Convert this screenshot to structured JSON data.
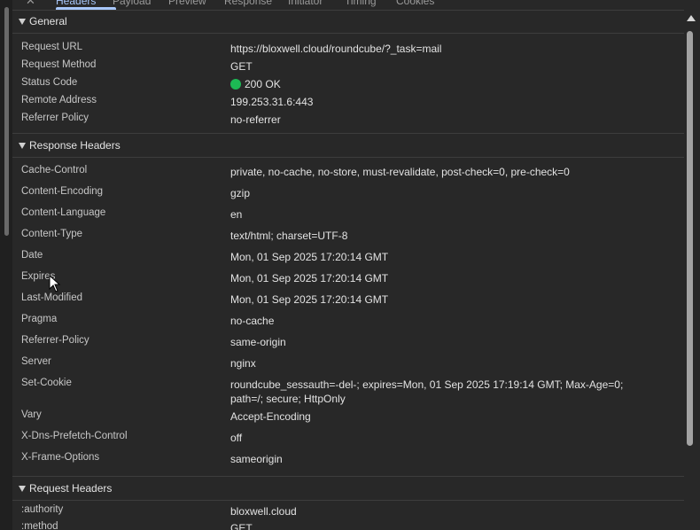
{
  "tabs": [
    {
      "label": "Headers",
      "active": true
    },
    {
      "label": "Payload"
    },
    {
      "label": "Preview"
    },
    {
      "label": "Response"
    },
    {
      "label": "Initiator"
    },
    {
      "label": "Timing"
    },
    {
      "label": "Cookies"
    }
  ],
  "general": {
    "title": "General",
    "rows": [
      {
        "key": "Request URL",
        "value": "https://bloxwell.cloud/roundcube/?_task=mail"
      },
      {
        "key": "Request Method",
        "value": "GET"
      },
      {
        "key": "Status Code",
        "value": "200 OK"
      },
      {
        "key": "Remote Address",
        "value": "199.253.31.6:443"
      },
      {
        "key": "Referrer Policy",
        "value": "no-referrer"
      }
    ]
  },
  "response_headers": {
    "title": "Response Headers",
    "rows": [
      {
        "key": "Cache-Control",
        "value": "private, no-cache, no-store, must-revalidate, post-check=0, pre-check=0"
      },
      {
        "key": "Content-Encoding",
        "value": "gzip"
      },
      {
        "key": "Content-Language",
        "value": "en"
      },
      {
        "key": "Content-Type",
        "value": "text/html; charset=UTF-8"
      },
      {
        "key": "Date",
        "value": "Mon, 01 Sep 2025 17:20:14 GMT"
      },
      {
        "key": "Expires",
        "value": "Mon, 01 Sep 2025 17:20:14 GMT"
      },
      {
        "key": "Last-Modified",
        "value": "Mon, 01 Sep 2025 17:20:14 GMT"
      },
      {
        "key": "Pragma",
        "value": "no-cache"
      },
      {
        "key": "Referrer-Policy",
        "value": "same-origin"
      },
      {
        "key": "Server",
        "value": "nginx"
      },
      {
        "key": "Set-Cookie",
        "value_line1": "roundcube_sessauth=-del-; expires=Mon, 01 Sep 2025 17:19:14 GMT; Max-Age=0;",
        "value_line2": "path=/; secure; HttpOnly"
      },
      {
        "key": "Vary",
        "value": "Accept-Encoding"
      },
      {
        "key": "X-Dns-Prefetch-Control",
        "value": "off"
      },
      {
        "key": "X-Frame-Options",
        "value": "sameorigin"
      }
    ]
  },
  "request_headers": {
    "title": "Request Headers",
    "rows": [
      {
        "key": ":authority",
        "value": "bloxwell.cloud"
      },
      {
        "key": ":method",
        "value": "GET"
      }
    ]
  },
  "colors": {
    "status_ok": "#1db954",
    "accent": "#a8c7fa",
    "background": "#282828"
  },
  "icons": [
    "close-icon",
    "disclosure-triangle-icon",
    "status-dot-icon",
    "scroll-up-arrow-icon",
    "mouse-cursor-icon"
  ]
}
